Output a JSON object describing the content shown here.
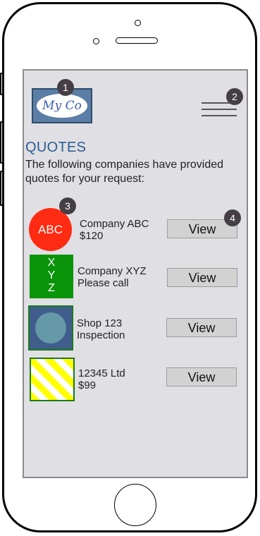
{
  "header": {
    "logo_text": "My Co",
    "menu_icon": "hamburger-menu-icon"
  },
  "badges": [
    "1",
    "2",
    "3",
    "4"
  ],
  "page": {
    "title": "QUOTES",
    "intro": "The following companies have provided quotes for your request:"
  },
  "quotes": [
    {
      "avatar_text": "ABC",
      "company": "Company ABC",
      "detail": "$120",
      "button": "View",
      "avatar_color": "#ff2b12"
    },
    {
      "avatar_text": "X Y Z",
      "company": "Company XYZ",
      "detail": "Please call",
      "button": "View",
      "avatar_color": "#0a9409"
    },
    {
      "avatar_text": "",
      "company": "Shop 123",
      "detail": "Inspection",
      "button": "View",
      "avatar_color": "#415d8c"
    },
    {
      "avatar_text": "",
      "company": "12345 Ltd",
      "detail": "$99",
      "button": "View",
      "avatar_color": "#ffff00"
    }
  ],
  "colors": {
    "screen_bg": "#e0dfe4",
    "title": "#2c5c93",
    "badge": "#453f45",
    "button_bg": "#d2d2d2"
  }
}
